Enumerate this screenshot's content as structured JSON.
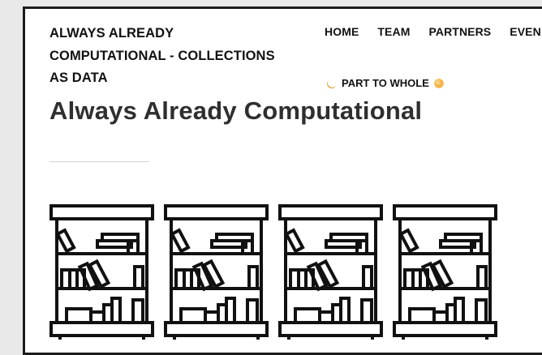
{
  "site": {
    "title_lines": [
      "ALWAYS ALREADY",
      "COMPUTATIONAL - COLLECTIONS",
      "AS DATA"
    ]
  },
  "nav": {
    "items": [
      {
        "label": "HOME"
      },
      {
        "label": "TEAM"
      },
      {
        "label": "PARTNERS"
      },
      {
        "label": "EVEN"
      }
    ],
    "secondary": {
      "label": "PART TO WHOLE",
      "leading_icon": "crescent-moon-icon",
      "trailing_icon": "sun-icon"
    }
  },
  "main": {
    "title": "Always Already Computational",
    "image": {
      "icon": "bookshelf-icon",
      "count": 4
    }
  },
  "colors": {
    "text": "#111111",
    "title": "#2f2f2f",
    "frame_border": "#1c1c1c",
    "moon": "#e6a83a",
    "sun": "#f0a63c"
  }
}
